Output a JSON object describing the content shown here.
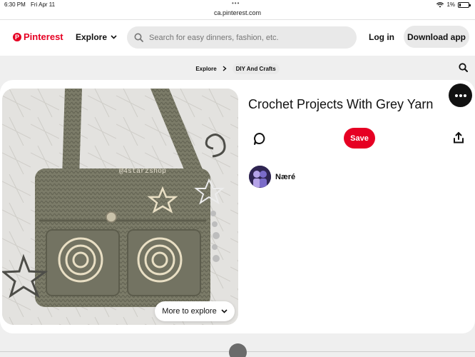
{
  "status_bar": {
    "time": "6:30 PM",
    "date": "Fri Apr 11",
    "battery": "1%"
  },
  "browser": {
    "url": "ca.pinterest.com"
  },
  "header": {
    "logo_text": "Pinterest",
    "explore_label": "Explore",
    "search_placeholder": "Search for easy dinners, fashion, etc.",
    "login_label": "Log in",
    "download_label": "Download app"
  },
  "breadcrumb": {
    "items": [
      "Explore",
      "DIY And Crafts"
    ]
  },
  "pin": {
    "title": "Crochet Projects With Grey Yarn",
    "save_label": "Save",
    "author": "Næré",
    "image_watermark": "@4starzshop",
    "more_label": "More to explore"
  },
  "colors": {
    "brand": "#e60023",
    "pill_bg": "#e9e9e9"
  },
  "icons": [
    "search-icon",
    "chevron-down-icon",
    "comment-icon",
    "share-icon",
    "ellipsis-icon",
    "wifi-icon",
    "battery-icon"
  ]
}
